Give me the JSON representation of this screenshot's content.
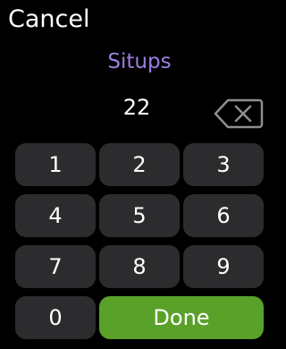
{
  "header": {
    "cancel_label": "Cancel",
    "title": "Situps",
    "value": "22"
  },
  "keypad": {
    "keys": [
      "1",
      "2",
      "3",
      "4",
      "5",
      "6",
      "7",
      "8",
      "9",
      "0"
    ],
    "done_label": "Done",
    "backspace_icon": "backspace-icon"
  },
  "colors": {
    "title": "#9b7ee0",
    "key_background": "#2c2c2e",
    "done_background": "#5aa12a",
    "background": "#000000"
  }
}
